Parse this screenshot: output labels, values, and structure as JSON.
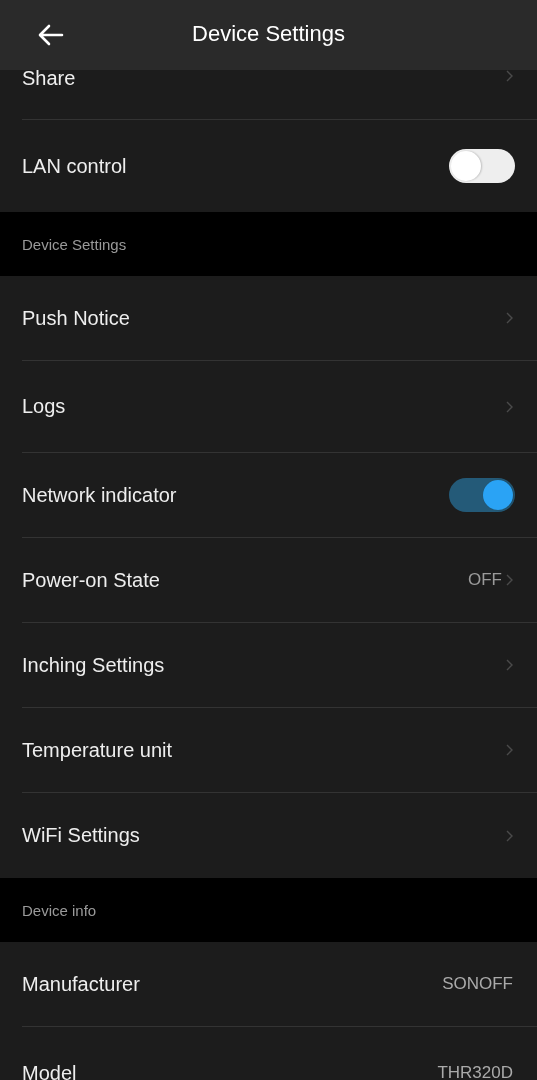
{
  "header": {
    "title": "Device Settings"
  },
  "sections": [
    {
      "rows": [
        {
          "kind": "link",
          "label": "Share"
        },
        {
          "kind": "toggle",
          "label": "LAN control",
          "on": false
        }
      ]
    },
    {
      "title": "Device Settings",
      "rows": [
        {
          "kind": "link",
          "label": "Push Notice"
        },
        {
          "kind": "link",
          "label": "Logs"
        },
        {
          "kind": "toggle",
          "label": "Network indicator",
          "on": true
        },
        {
          "kind": "link",
          "label": "Power-on State",
          "value": "OFF"
        },
        {
          "kind": "link",
          "label": "Inching Settings"
        },
        {
          "kind": "link",
          "label": "Temperature unit"
        },
        {
          "kind": "link",
          "label": "WiFi Settings"
        }
      ]
    },
    {
      "title": "Device info",
      "rows": [
        {
          "kind": "info",
          "label": "Manufacturer",
          "value": "SONOFF"
        },
        {
          "kind": "info",
          "label": "Model",
          "value": "THR320D"
        }
      ]
    }
  ]
}
